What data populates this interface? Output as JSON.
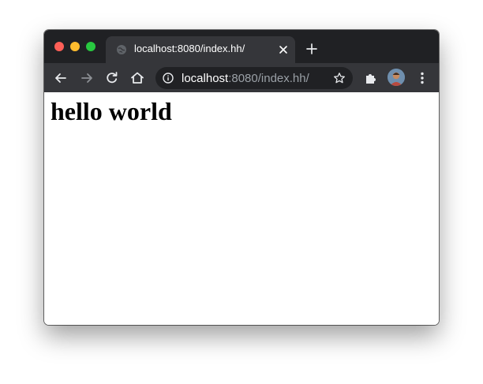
{
  "tab": {
    "title": "localhost:8080/index.hh/"
  },
  "address_bar": {
    "host": "localhost",
    "rest": ":8080/index.hh/"
  },
  "page": {
    "heading": "hello world"
  },
  "icons": {
    "favicon": "globe-icon",
    "close": "close-icon",
    "new_tab": "plus-icon",
    "back": "back-arrow-icon",
    "forward": "forward-arrow-icon",
    "reload": "reload-icon",
    "home": "home-icon",
    "site_info": "info-icon",
    "bookmark": "star-icon",
    "extensions": "puzzle-icon",
    "profile": "avatar",
    "menu": "kebab-menu-icon"
  },
  "colors": {
    "tabstrip": "#202124",
    "toolbar": "#35363a",
    "omnibox": "#202124",
    "url_secondary": "#9aa0a6",
    "close_red": "#ff5f57",
    "minimize_yellow": "#febc2e",
    "zoom_green": "#28c840"
  }
}
